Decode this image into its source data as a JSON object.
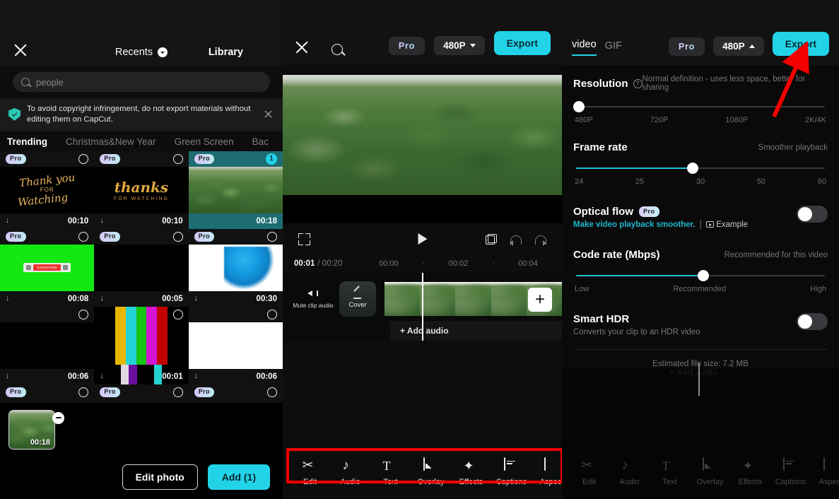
{
  "panel1": {
    "header": {
      "close_icon": "close-icon",
      "title": "Recents",
      "library_tab": "Library"
    },
    "search": {
      "value": "people",
      "icon": "search-icon"
    },
    "notice": {
      "text": "To avoid copyright infringement, do not export materials without editing them on CapCut.",
      "icon": "shield-check-icon",
      "close_icon": "close-icon"
    },
    "tabs": [
      {
        "label": "Trending",
        "active": true
      },
      {
        "label": "Christmas&New Year",
        "active": false
      },
      {
        "label": "Green Screen",
        "active": false
      },
      {
        "label": "Bac",
        "active": false
      }
    ],
    "media": [
      {
        "pro": true,
        "duration": "00:10",
        "selected": false,
        "badge": null,
        "kind": "thanks-script"
      },
      {
        "pro": true,
        "duration": "00:10",
        "selected": false,
        "badge": null,
        "kind": "thanks-bold"
      },
      {
        "pro": true,
        "duration": "00:18",
        "selected": true,
        "badge": "1",
        "kind": "forest"
      },
      {
        "pro": true,
        "duration": "00:08",
        "selected": false,
        "badge": null,
        "kind": "green-screen"
      },
      {
        "pro": true,
        "duration": "00:05",
        "selected": false,
        "badge": null,
        "kind": "black"
      },
      {
        "pro": true,
        "duration": "00:30",
        "selected": false,
        "badge": null,
        "kind": "blue-ink"
      },
      {
        "pro": false,
        "duration": "00:06",
        "selected": false,
        "badge": null,
        "kind": "black"
      },
      {
        "pro": false,
        "duration": "00:01",
        "selected": false,
        "badge": null,
        "kind": "color-bars"
      },
      {
        "pro": false,
        "duration": "00:06",
        "selected": false,
        "badge": null,
        "kind": "white"
      },
      {
        "pro": true,
        "duration": "",
        "selected": false,
        "badge": null,
        "kind": "empty"
      },
      {
        "pro": true,
        "duration": "",
        "selected": false,
        "badge": null,
        "kind": "empty"
      },
      {
        "pro": true,
        "duration": "",
        "selected": false,
        "badge": null,
        "kind": "empty"
      }
    ],
    "tray": {
      "duration": "00:18",
      "remove_icon": "minus-icon"
    },
    "footer": {
      "edit_photo": "Edit photo",
      "add": "Add (1)"
    },
    "pro_badge_label": "Pro",
    "download_icon": "download-arrow-icon"
  },
  "panel2": {
    "header": {
      "close_icon": "close-icon",
      "search_icon": "search-icon",
      "pro_label": "Pro",
      "resolution": "480P",
      "export": "Export"
    },
    "controls": {
      "fullscreen_icon": "expand-icon",
      "play_icon": "play-icon",
      "duplicate_icon": "copy-icon",
      "undo_icon": "undo-icon",
      "redo_icon": "redo-icon"
    },
    "timeline": {
      "current": "00:01",
      "total": "/ 00:20",
      "ticks": [
        "00:00",
        "·",
        "00:02",
        "·",
        "00:04"
      ],
      "mute_label": "Mute clip audio",
      "cover_label": "Cover",
      "add_audio": "+ Add audio",
      "add_clip_icon": "plus-icon"
    },
    "toolbar": [
      {
        "label": "Edit",
        "icon": "scissors-icon"
      },
      {
        "label": "Audio",
        "icon": "music-note-icon"
      },
      {
        "label": "Text",
        "icon": "text-icon"
      },
      {
        "label": "Overlay",
        "icon": "overlay-image-icon"
      },
      {
        "label": "Effects",
        "icon": "sparkle-star-icon"
      },
      {
        "label": "Captions",
        "icon": "captions-icon"
      },
      {
        "label": "Aspect",
        "icon": "aspect-ratio-icon"
      }
    ]
  },
  "panel3": {
    "header": {
      "video_tab": "video",
      "gif_tab": "GIF",
      "pro_label": "Pro",
      "resolution": "480P",
      "export": "Export"
    },
    "resolution": {
      "title": "Resolution",
      "help_icon": "question-icon",
      "note": "Normal definition - uses less space, better for sharing",
      "labels": [
        "480P",
        "720P",
        "1080P",
        "2K/4K"
      ],
      "value_pct": 0
    },
    "frame_rate": {
      "title": "Frame rate",
      "note": "Smoother playback",
      "labels": [
        "24",
        "25",
        "30",
        "50",
        "60"
      ],
      "value_pct": 46
    },
    "optical_flow": {
      "title": "Optical flow",
      "pro_label": "Pro",
      "sub_link": "Make video playback smoother.",
      "sub_divider": "|",
      "example": "Example",
      "enabled": false
    },
    "code_rate": {
      "title": "Code rate (Mbps)",
      "note": "Recommended for this video",
      "labels": [
        "Low",
        "Recommended",
        "High"
      ],
      "value_pct": 51
    },
    "smart_hdr": {
      "title": "Smart HDR",
      "sub": "Converts your clip to an HDR video",
      "enabled": false
    },
    "estimate": "Estimated file size: 7.2 MB",
    "toolbar": [
      {
        "label": "Edit",
        "icon": "scissors-icon"
      },
      {
        "label": "Audio",
        "icon": "music-note-icon"
      },
      {
        "label": "Text",
        "icon": "text-icon"
      },
      {
        "label": "Overlay",
        "icon": "overlay-image-icon"
      },
      {
        "label": "Effects",
        "icon": "sparkle-star-icon"
      },
      {
        "label": "Captions",
        "icon": "captions-icon"
      },
      {
        "label": "Aspect",
        "icon": "aspect-ratio-icon"
      }
    ],
    "add_audio": "+ Add audio"
  },
  "annotations": {
    "highlight_box_color": "#f40000",
    "arrow_color": "#f40000"
  },
  "thumb_text": {
    "thanks1_l1": "Thank you",
    "thanks1_l2": "FOR",
    "thanks1_l3": "Watching",
    "thanks2_l1": "thanks",
    "thanks2_l2": "FOR WATCHING",
    "subscribe": "SUBSCRIBE"
  }
}
